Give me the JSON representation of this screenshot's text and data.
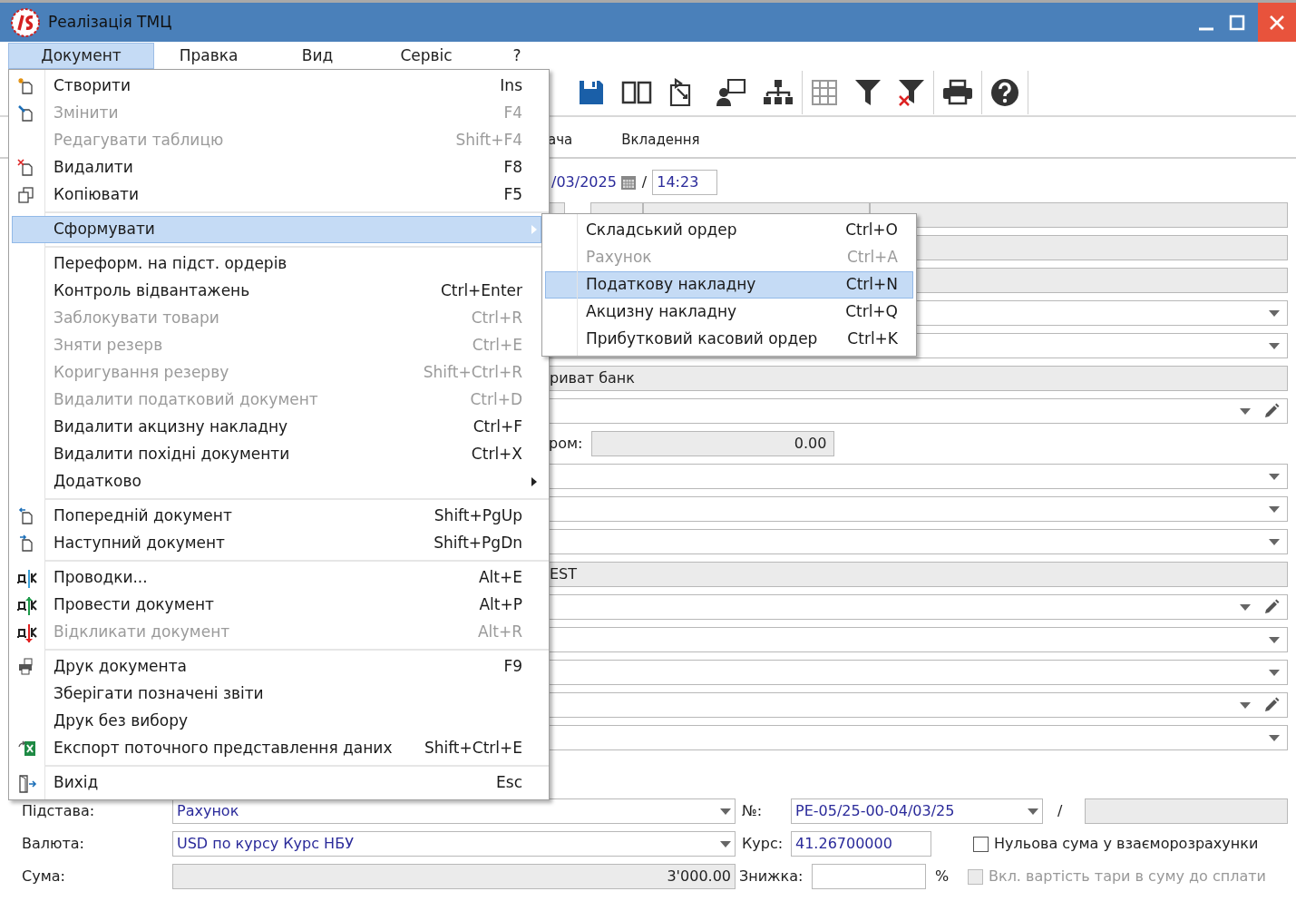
{
  "window": {
    "title": "Реалізація ТМЦ"
  },
  "menubar": [
    {
      "label": "Документ",
      "selected": true
    },
    {
      "label": "Правка",
      "selected": false
    },
    {
      "label": "Вид",
      "selected": false
    },
    {
      "label": "Сервіс",
      "selected": false
    },
    {
      "label": "?",
      "selected": false
    }
  ],
  "tabs": [
    {
      "label": "ача"
    },
    {
      "label": "Вкладення"
    }
  ],
  "fields": [
    {
      "kind": "datetime",
      "date": "/03/2025",
      "separator": "/",
      "time": "14:23"
    },
    {
      "kind": "readonly_split"
    },
    {
      "kind": "readonly"
    },
    {
      "kind": "readonly"
    },
    {
      "kind": "dropdown"
    },
    {
      "kind": "dropdown"
    },
    {
      "kind": "readonly",
      "value": "риват банк"
    },
    {
      "kind": "dropdown_edit"
    },
    {
      "kind": "amount",
      "label": "ром:",
      "value": "0.00"
    },
    {
      "kind": "dropdown"
    },
    {
      "kind": "dropdown"
    },
    {
      "kind": "dropdown"
    },
    {
      "kind": "readonly",
      "value": "EST"
    },
    {
      "kind": "dropdown_edit"
    },
    {
      "kind": "dropdown"
    },
    {
      "kind": "dropdown"
    },
    {
      "kind": "dropdown_edit"
    },
    {
      "kind": "dropdown"
    }
  ],
  "basis_row": {
    "label": "Підстава:",
    "value": "Рахунок",
    "number_label": "№:",
    "number": "PE-05/25-00-04/03/25",
    "separator": "/"
  },
  "currency_row": {
    "label": "Валюта:",
    "value": "USD по курсу Курс НБУ",
    "rate_label": "Курс:",
    "rate": "41.26700000",
    "checkbox": {
      "label": "Нульова сума у взаєморозрахунки",
      "checked": false,
      "disabled": false
    }
  },
  "sum_row": {
    "label": "Сума:",
    "value": "3'000.00",
    "discount_label": "Знижка:",
    "percent": "%",
    "checkbox": {
      "label": "Вкл. вартість тари в суму до сплати",
      "checked": false,
      "disabled": true
    }
  },
  "menu": {
    "groups": [
      {
        "items": [
          {
            "label": "Створити",
            "shortcut": "Ins",
            "disabled": false,
            "selected": false,
            "submenu": false
          },
          {
            "label": "Змінити",
            "shortcut": "F4",
            "disabled": true,
            "selected": false,
            "submenu": false
          },
          {
            "label": "Редагувати таблицю",
            "shortcut": "Shift+F4",
            "disabled": true,
            "selected": false,
            "submenu": false
          },
          {
            "label": "Видалити",
            "shortcut": "F8",
            "disabled": false,
            "selected": false,
            "submenu": false
          },
          {
            "label": "Копіювати",
            "shortcut": "F5",
            "disabled": false,
            "selected": false,
            "submenu": false
          }
        ]
      },
      {
        "items": [
          {
            "label": "Сформувати",
            "disabled": false,
            "selected": true,
            "submenu": true
          }
        ]
      },
      {
        "items": [
          {
            "label": "Переформ. на підст. ордерів",
            "disabled": false,
            "selected": false,
            "submenu": false
          },
          {
            "label": "Контроль відвантажень",
            "shortcut": "Ctrl+Enter",
            "disabled": false,
            "selected": false,
            "submenu": false
          },
          {
            "label": "Заблокувати товари",
            "shortcut": "Ctrl+R",
            "disabled": true,
            "selected": false,
            "submenu": false
          },
          {
            "label": "Зняти резерв",
            "shortcut": "Ctrl+E",
            "disabled": true,
            "selected": false,
            "submenu": false
          },
          {
            "label": "Коригування резерву",
            "shortcut": "Shift+Ctrl+R",
            "disabled": true,
            "selected": false,
            "submenu": false
          },
          {
            "label": "Видалити податковий документ",
            "shortcut": "Ctrl+D",
            "disabled": true,
            "selected": false,
            "submenu": false
          },
          {
            "label": "Видалити акцизну накладну",
            "shortcut": "Ctrl+F",
            "disabled": false,
            "selected": false,
            "submenu": false
          },
          {
            "label": "Видалити похідні документи",
            "shortcut": "Ctrl+X",
            "disabled": false,
            "selected": false,
            "submenu": false
          },
          {
            "label": "Додатково",
            "disabled": false,
            "selected": false,
            "submenu": true
          }
        ]
      },
      {
        "items": [
          {
            "label": "Попередній документ",
            "shortcut": "Shift+PgUp",
            "disabled": false,
            "selected": false,
            "submenu": false
          },
          {
            "label": "Наступний документ",
            "shortcut": "Shift+PgDn",
            "disabled": false,
            "selected": false,
            "submenu": false
          }
        ]
      },
      {
        "items": [
          {
            "label": "Проводки...",
            "shortcut": "Alt+E",
            "disabled": false,
            "selected": false,
            "submenu": false
          },
          {
            "label": "Провести документ",
            "shortcut": "Alt+P",
            "disabled": false,
            "selected": false,
            "submenu": false
          },
          {
            "label": "Відкликати документ",
            "shortcut": "Alt+R",
            "disabled": true,
            "selected": false,
            "submenu": false
          }
        ]
      },
      {
        "items": [
          {
            "label": "Друк документа",
            "shortcut": "F9",
            "disabled": false,
            "selected": false,
            "submenu": false
          },
          {
            "label": "Зберігати позначені звіти",
            "disabled": false,
            "selected": false,
            "submenu": false
          },
          {
            "label": "Друк без вибору",
            "disabled": false,
            "selected": false,
            "submenu": false
          },
          {
            "label": "Експорт поточного представлення даних",
            "shortcut": "Shift+Ctrl+E",
            "disabled": false,
            "selected": false,
            "submenu": false
          }
        ]
      },
      {
        "items": [
          {
            "label": "Вихід",
            "shortcut": "Esc",
            "disabled": false,
            "selected": false,
            "submenu": false
          }
        ]
      }
    ]
  },
  "submenu": [
    {
      "label": "Складський ордер",
      "shortcut": "Ctrl+O",
      "disabled": false,
      "selected": false
    },
    {
      "label": "Рахунок",
      "shortcut": "Ctrl+A",
      "disabled": true,
      "selected": false
    },
    {
      "label": "Податкову накладну",
      "shortcut": "Ctrl+N",
      "disabled": false,
      "selected": true
    },
    {
      "label": "Акцизну накладну",
      "shortcut": "Ctrl+Q",
      "disabled": false,
      "selected": false
    },
    {
      "label": "Прибутковий касовий ордер",
      "shortcut": "Ctrl+K",
      "disabled": false,
      "selected": false
    }
  ]
}
